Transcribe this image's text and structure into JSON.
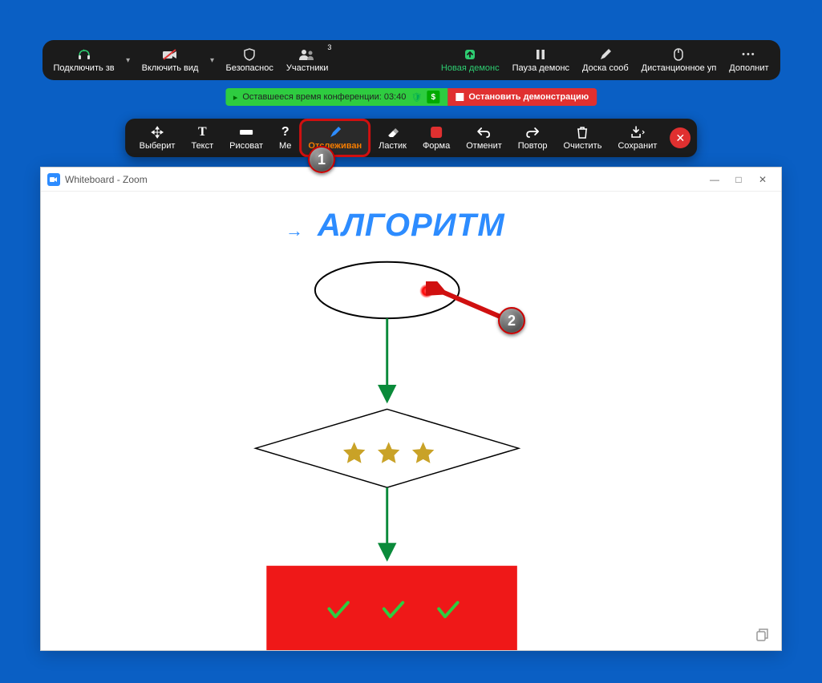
{
  "main_toolbar": {
    "audio": "Подключить зв",
    "video": "Включить вид",
    "security": "Безопаснос",
    "participants": "Участники",
    "participants_count": "3",
    "new_share": "Новая демонс",
    "pause_share": "Пауза демонс",
    "whiteboard": "Доска сооб",
    "remote": "Дистанционное уп",
    "more": "Дополнит"
  },
  "timer": {
    "text": "Оставшееся время конференции: 03:40",
    "stop": "Остановить демонстрацию"
  },
  "anno_toolbar": {
    "select": "Выберит",
    "text": "Текст",
    "draw": "Рисоват",
    "ques": "Ме",
    "spotlight": "Отслеживан",
    "eraser": "Ластик",
    "format": "Форма",
    "undo": "Отменит",
    "redo": "Повтор",
    "clear": "Очистить",
    "save": "Сохранит"
  },
  "steps": {
    "one": "1",
    "two": "2"
  },
  "window": {
    "title": "Whiteboard - Zoom"
  },
  "canvas": {
    "title": "АЛГОРИТМ",
    "arrow": "→"
  },
  "icons": {
    "dollar": "$",
    "dots": "•••",
    "minus": "—",
    "square": "□",
    "close": "✕",
    "caret": "▾",
    "share_up": "↑"
  }
}
